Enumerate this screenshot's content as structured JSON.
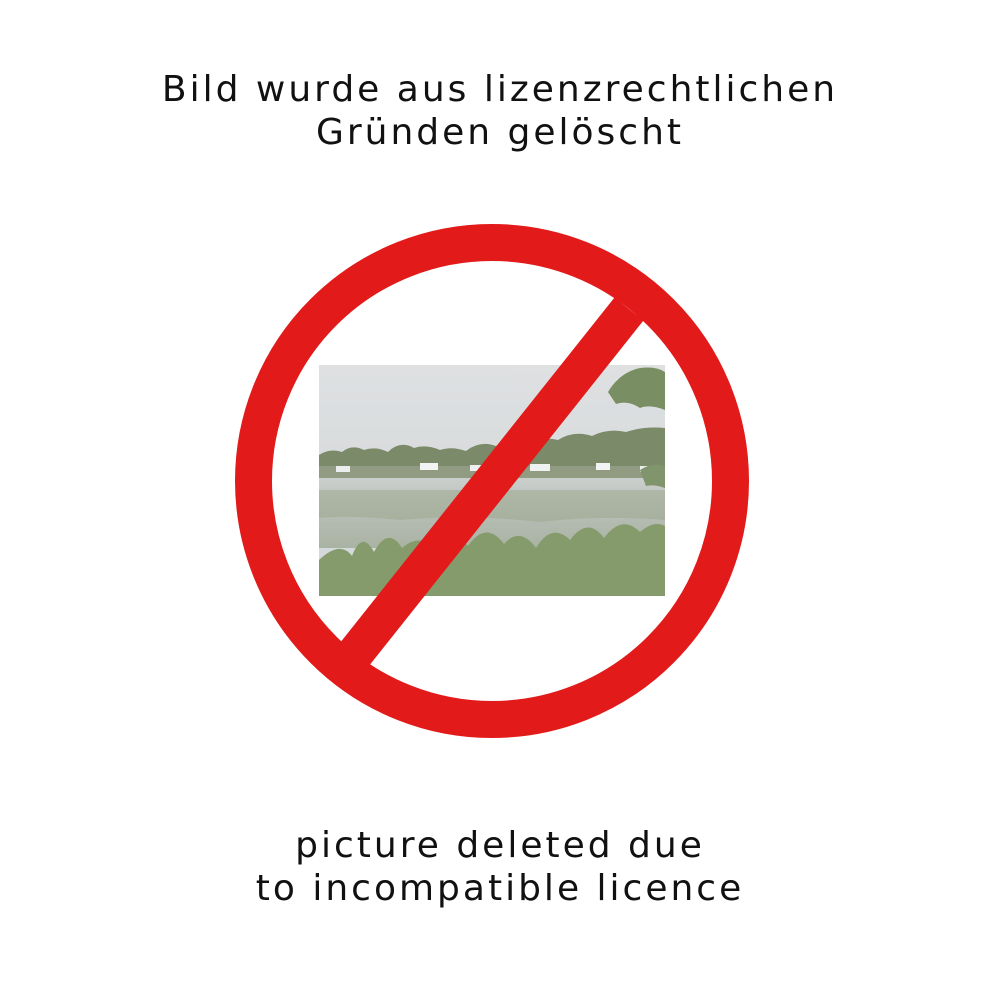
{
  "notice_de": {
    "line1": "Bild wurde aus lizenzrechtlichen",
    "line2": "Gründen gelöscht"
  },
  "notice_en": {
    "line1": "picture deleted due",
    "line2": "to incompatible licence"
  },
  "sign": {
    "icon": "prohibition-sign-icon",
    "color": "#e21a1a"
  },
  "photo": {
    "subject": "lake-landscape-thumbnail",
    "sky_color": "#c9cdd0",
    "treeline_color": "#5d6e42",
    "water_color": "#a7afa8",
    "grass_color": "#6f8a4c"
  }
}
